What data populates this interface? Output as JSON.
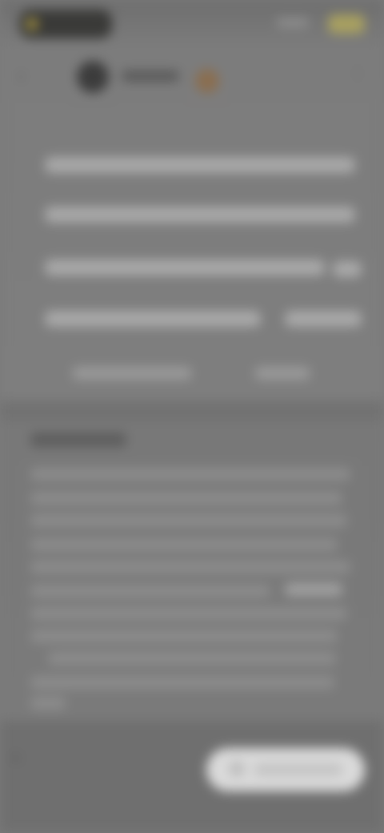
{
  "status_bar": {
    "pill_icon": "recording-dot-icon",
    "signal_icon": "signal-icon",
    "battery_icon": "battery-icon"
  },
  "nav": {
    "back_icon": "back-arrow-icon",
    "avatar_icon": "avatar",
    "badge_icon": "emoji-badge-icon",
    "more_icon": "more-vertical-icon"
  },
  "bottom_bar": {
    "left_icon": "menu-icon",
    "action_icon": "action-icon"
  },
  "colors": {
    "background": "#7a7a7a",
    "button": "#dadada"
  }
}
